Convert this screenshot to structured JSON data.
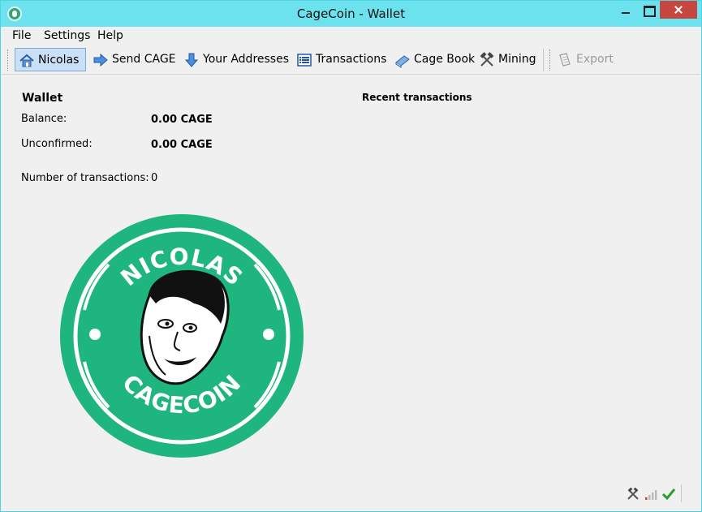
{
  "window": {
    "title": "CageCoin - Wallet"
  },
  "menu": [
    {
      "label": "File"
    },
    {
      "label": "Settings"
    },
    {
      "label": "Help"
    }
  ],
  "toolbar": {
    "nicolas": "Nicolas",
    "send": "Send CAGE",
    "addresses": "Your Addresses",
    "transactions": "Transactions",
    "cagebook": "Cage Book",
    "mining": "Mining",
    "export": "Export"
  },
  "wallet": {
    "heading": "Wallet",
    "balance_label": "Balance:",
    "balance_value": "0.00 CAGE",
    "unconfirmed_label": "Unconfirmed:",
    "unconfirmed_value": "0.00 CAGE",
    "num_tx_label": "Number of transactions:",
    "num_tx_value": "0"
  },
  "recent": {
    "heading": "Recent transactions"
  },
  "logo": {
    "top_text": "NICOLAS",
    "bottom_text": "CAGECOIN",
    "color": "#1fb57f"
  },
  "colors": {
    "titlebar": "#6ce2ee",
    "close": "#c7463f",
    "active_tab": "#c9e0f7"
  }
}
